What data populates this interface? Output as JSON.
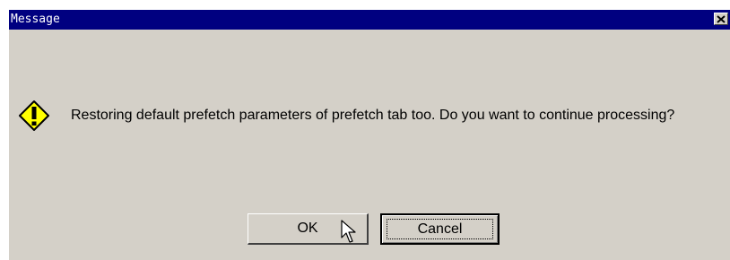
{
  "window": {
    "title": "Message",
    "close_label": "Close"
  },
  "message": {
    "icon": "warning-exclamation-icon",
    "text": "Restoring default prefetch parameters of prefetch tab too. Do you want to continue processing?"
  },
  "buttons": {
    "ok_label": "OK",
    "cancel_label": "Cancel"
  },
  "colors": {
    "titlebar": "#000080",
    "dialog_background": "#d4d0c8",
    "icon_fill": "#ffff00",
    "text": "#000000"
  }
}
